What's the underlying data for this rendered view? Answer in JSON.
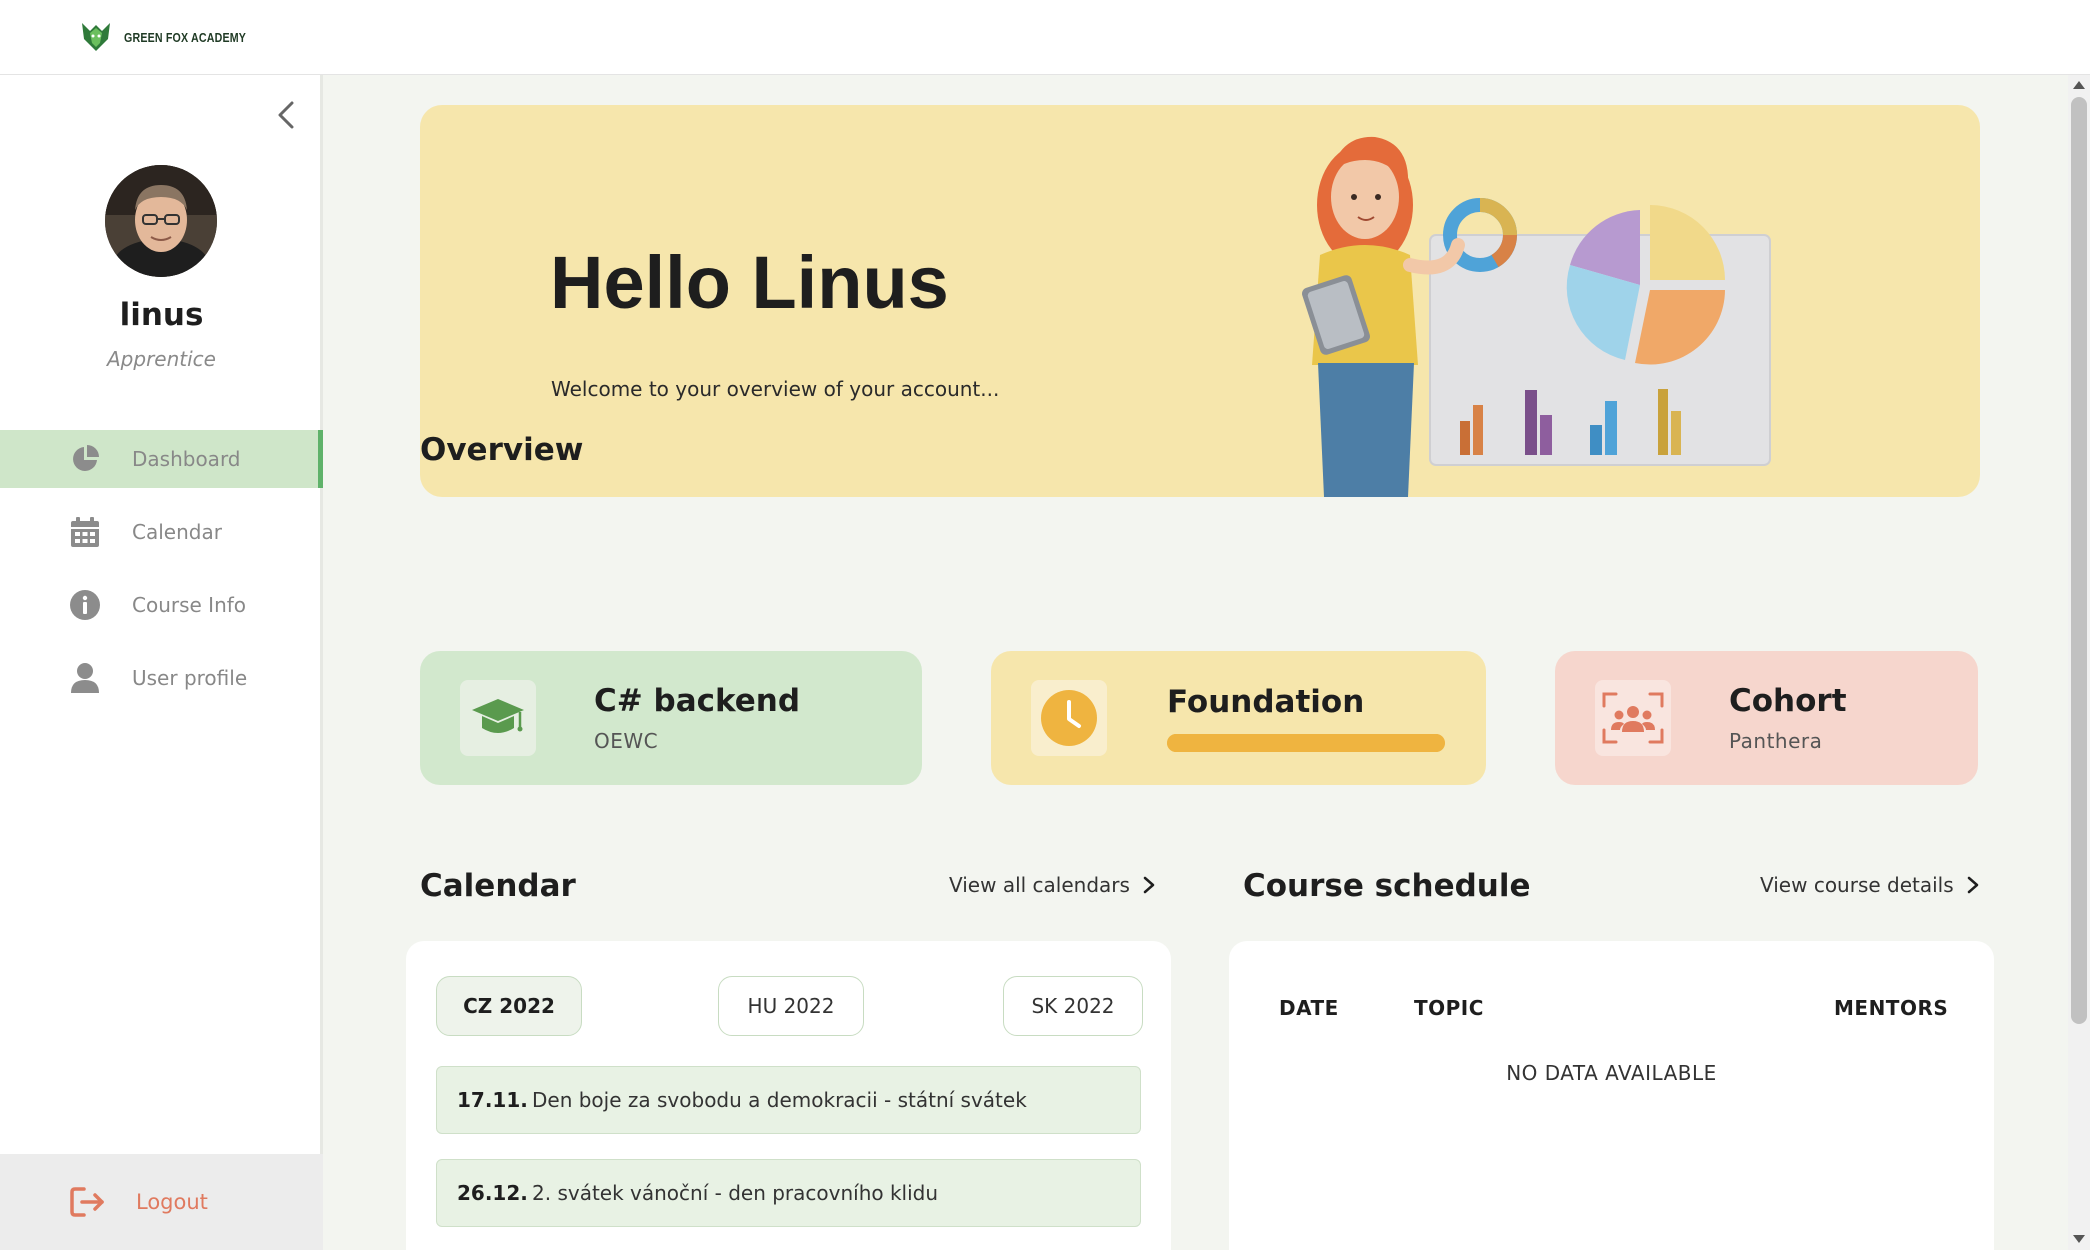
{
  "header": {
    "logo_text": "GREEN FOX ACADEMY"
  },
  "sidebar": {
    "user": {
      "name": "linus",
      "role": "Apprentice"
    },
    "items": [
      {
        "label": "Dashboard",
        "icon": "pie-chart-icon",
        "active": true
      },
      {
        "label": "Calendar",
        "icon": "calendar-icon",
        "active": false
      },
      {
        "label": "Course Info",
        "icon": "info-icon",
        "active": false
      },
      {
        "label": "User profile",
        "icon": "user-icon",
        "active": false
      }
    ],
    "logout_label": "Logout"
  },
  "hero": {
    "title": "Hello Linus",
    "subtitle": "Welcome to your overview of your account..."
  },
  "overview": {
    "title": "Overview",
    "cards": [
      {
        "title": "C# backend",
        "subtitle": "OEWC",
        "icon": "graduation-cap-icon",
        "color": "#d2e8cd"
      },
      {
        "title": "Foundation",
        "progress": 1.0,
        "icon": "clock-icon",
        "color": "#f6e6ac"
      },
      {
        "title": "Cohort",
        "subtitle": "Panthera",
        "icon": "group-icon",
        "color": "#f6d6cd"
      }
    ]
  },
  "calendar": {
    "title": "Calendar",
    "view_all_label": "View all calendars",
    "tabs": [
      "CZ 2022",
      "HU 2022",
      "SK 2022"
    ],
    "active_tab": "CZ 2022",
    "holidays": [
      {
        "date": "17.11.",
        "text": "Den boje za svobodu a demokracii - státní svátek"
      },
      {
        "date": "26.12.",
        "text": "2. svátek vánoční - den pracovního klidu"
      }
    ]
  },
  "schedule": {
    "title": "Course schedule",
    "view_details_label": "View course details",
    "columns": [
      "DATE",
      "TOPIC",
      "MENTORS"
    ],
    "empty_text": "NO DATA AVAILABLE"
  },
  "colors": {
    "accent_green": "#5fb26a",
    "logout_orange": "#e07a5f",
    "progress_orange": "#efb440",
    "hero_bg": "#f6e6ac"
  }
}
